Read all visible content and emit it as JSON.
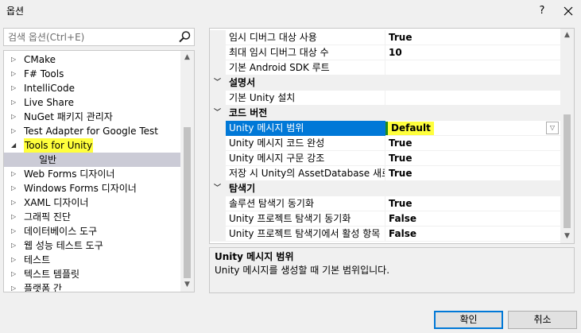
{
  "window": {
    "title": "옵션",
    "help_glyph": "?",
    "close_glyph": "✕"
  },
  "search": {
    "placeholder": "검색 옵션(Ctrl+E)",
    "icon": "search-icon"
  },
  "tree": {
    "items": [
      {
        "label": "CMake",
        "expanded": false
      },
      {
        "label": "F# Tools",
        "expanded": false
      },
      {
        "label": "IntelliCode",
        "expanded": false
      },
      {
        "label": "Live Share",
        "expanded": false
      },
      {
        "label": "NuGet 패키지 관리자",
        "expanded": false
      },
      {
        "label": "Test Adapter for Google Test",
        "expanded": false
      },
      {
        "label": "Tools for Unity",
        "expanded": true,
        "highlighted": true
      },
      {
        "label": "일반",
        "child": true,
        "selected": true
      },
      {
        "label": "Web Forms 디자이너",
        "expanded": false
      },
      {
        "label": "Windows Forms 디자이너",
        "expanded": false
      },
      {
        "label": "XAML 디자이너",
        "expanded": false
      },
      {
        "label": "그래픽 진단",
        "expanded": false
      },
      {
        "label": "데이터베이스 도구",
        "expanded": false
      },
      {
        "label": "웹 성능 테스트 도구",
        "expanded": false
      },
      {
        "label": "테스트",
        "expanded": false
      },
      {
        "label": "텍스트 템플릿",
        "expanded": false
      },
      {
        "label": "플랫폼 간",
        "expanded": false
      }
    ]
  },
  "grid": {
    "rows": [
      {
        "type": "prop",
        "name": "임시 디버그 대상 사용",
        "value": "True"
      },
      {
        "type": "prop",
        "name": "최대 임시 디버그 대상 수",
        "value": "10"
      },
      {
        "type": "prop",
        "name": "기본 Android SDK 루트",
        "value": ""
      },
      {
        "type": "cat",
        "name": "설명서"
      },
      {
        "type": "prop",
        "name": "기본 Unity 설치",
        "value": ""
      },
      {
        "type": "cat",
        "name": "코드 버전"
      },
      {
        "type": "prop",
        "name": "Unity 메시지 범위",
        "value": "Default",
        "selected": true
      },
      {
        "type": "prop",
        "name": "Unity 메시지 코드 완성",
        "value": "True"
      },
      {
        "type": "prop",
        "name": "Unity 메시지 구문 강조",
        "value": "True"
      },
      {
        "type": "prop",
        "name": "저장 시 Unity의 AssetDatabase 새로",
        "value": "True"
      },
      {
        "type": "cat",
        "name": "탐색기"
      },
      {
        "type": "prop",
        "name": "솔루션 탐색기 동기화",
        "value": "True"
      },
      {
        "type": "prop",
        "name": "Unity 프로젝트 탐색기 동기화",
        "value": "False"
      },
      {
        "type": "prop",
        "name": "Unity 프로젝트 탐색기에서 활성 항목",
        "value": "False"
      }
    ]
  },
  "description": {
    "title": "Unity 메시지 범위",
    "text": "Unity 메시지를 생성할 때 기본 범위입니다."
  },
  "buttons": {
    "ok": "확인",
    "cancel": "취소"
  },
  "colors": {
    "selection": "#0078d7",
    "highlight": "#ffff3c"
  }
}
